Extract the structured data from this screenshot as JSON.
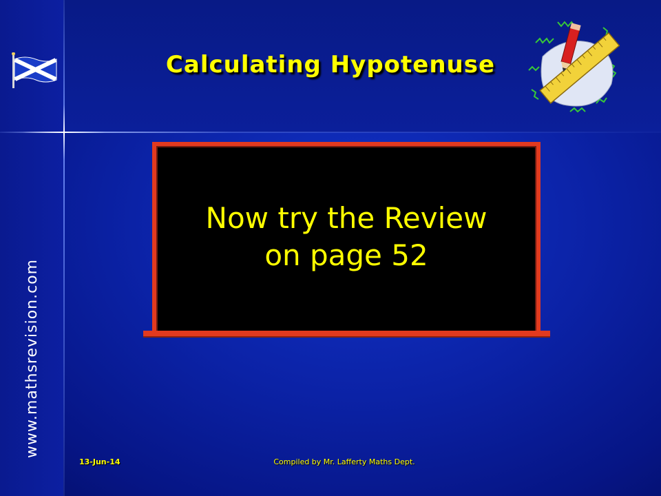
{
  "slide": {
    "title": "Calculating Hypotenuse",
    "website": "www.mathsrevision.com",
    "board": {
      "line1": "Now try the Review",
      "line2": "on page 52"
    },
    "footer": {
      "date": "13-Jun-14",
      "credit": "Compiled by Mr. Lafferty Maths Dept."
    }
  },
  "colors": {
    "background": "#0b22a6",
    "title": "#ffff00",
    "board": "#000000",
    "board_frame": "#e23a1f",
    "board_text": "#ffff00"
  },
  "icons": {
    "flag": "scottish-flag-icon",
    "clipart": "pencil-ruler-clipart-icon"
  }
}
